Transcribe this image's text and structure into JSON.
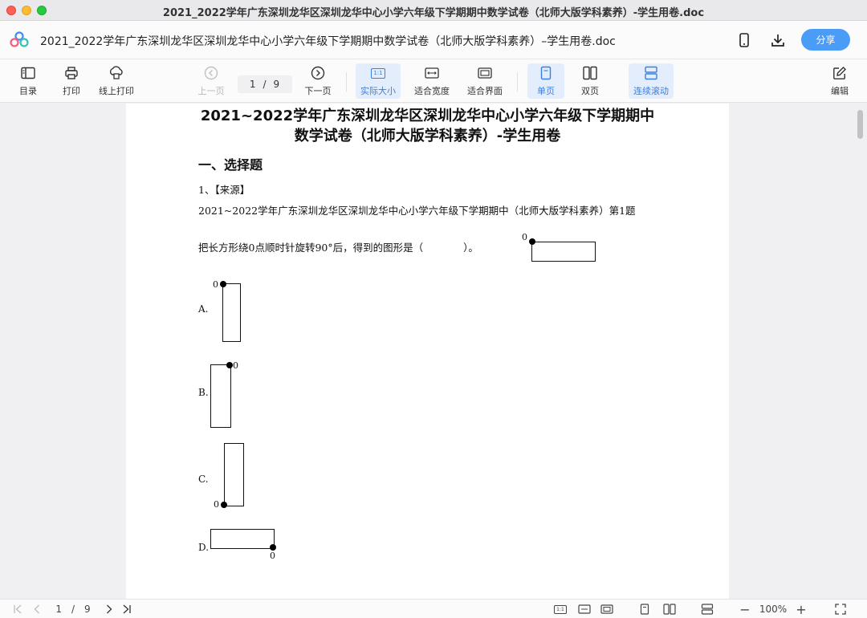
{
  "window": {
    "title": "2021_2022学年广东深圳龙华区深圳龙华中心小学六年级下学期期中数学试卷（北师大版学科素养）-学生用卷.doc"
  },
  "header": {
    "doc_title": "2021_2022学年广东深圳龙华区深圳龙华中心小学六年级下学期期中数学试卷（北师大版学科素养）–学生用卷.doc",
    "share_label": "分享",
    "icons": [
      "logo-icon",
      "phone-icon",
      "download-icon"
    ],
    "accent_color": "#4a9cf7"
  },
  "toolbar": {
    "toc": "目录",
    "print": "打印",
    "online_print": "线上打印",
    "prev_page": "上一页",
    "page_current": "1",
    "page_sep": "/",
    "page_total": "9",
    "next_page": "下一页",
    "actual_size": "实际大小",
    "actual_size_icon_text": "1:1",
    "fit_width": "适合宽度",
    "fit_page": "适合界面",
    "single_page": "单页",
    "double_page": "双页",
    "continuous_scroll": "连续滚动",
    "edit": "编辑"
  },
  "document": {
    "title_line1": "2021~2022学年广东深圳龙华区深圳龙华中心小学六年级下学期期中",
    "title_line2": "数学试卷（北师大版学科素养）-学生用卷",
    "section_heading": "一、选择题",
    "q1_number": "1、【来源】",
    "q1_source": "2021~2022学年广东深圳龙华区深圳龙华中心小学六年级下学期期中（北师大版学科素养）第1题",
    "q1_stem": "把长方形绕0点顺时针旋转90°后，得到的图形是（　　　　）。",
    "point_label": "0",
    "options": [
      "A.",
      "B.",
      "C.",
      "D."
    ]
  },
  "statusbar": {
    "page_current": "1",
    "page_sep": "/",
    "page_total": "9",
    "zoom": "100%",
    "minus": "−",
    "plus": "+",
    "actual_size_icon_text": "1:1"
  }
}
